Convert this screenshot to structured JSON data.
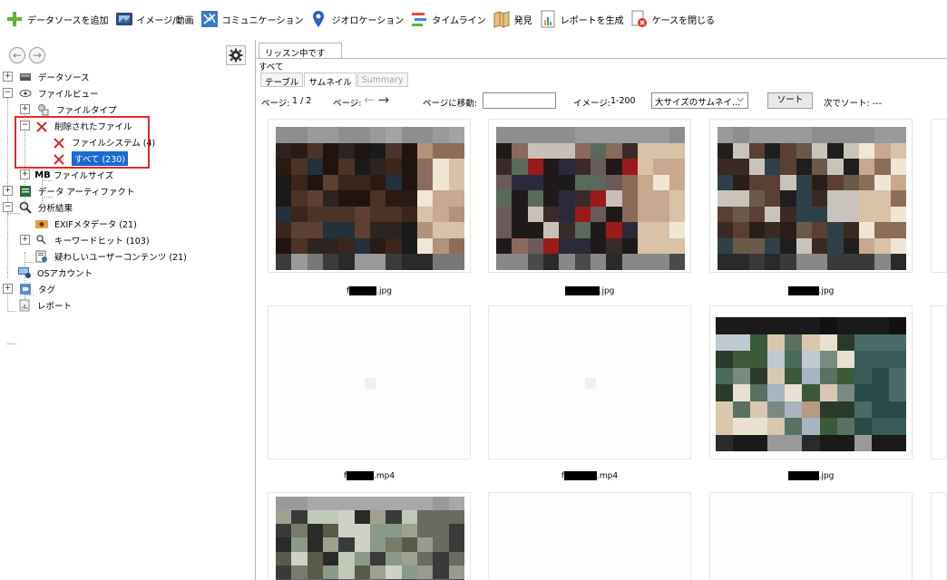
{
  "toolbar": {
    "items": [
      {
        "label": "データソースを追加",
        "icon": "add-plus-icon"
      },
      {
        "label": "イメージ/動画",
        "icon": "image-video-icon"
      },
      {
        "label": "コミュニケーション",
        "icon": "communication-icon"
      },
      {
        "label": "ジオロケーション",
        "icon": "geolocation-pin-icon"
      },
      {
        "label": "タイムライン",
        "icon": "timeline-icon"
      },
      {
        "label": "発見",
        "icon": "discovery-icon"
      },
      {
        "label": "レポートを生成",
        "icon": "report-icon"
      },
      {
        "label": "ケースを閉じる",
        "icon": "close-case-icon"
      }
    ]
  },
  "tree": {
    "items": [
      {
        "label": "データソース",
        "icon": "data-source-icon",
        "expander": "+"
      },
      {
        "label": "ファイルビュー",
        "icon": "eye-icon",
        "expander": "−"
      },
      {
        "label": "ファイルタイプ",
        "icon": "file-type-icon",
        "expander": "+"
      },
      {
        "label": "削除されたファイル",
        "icon": "deleted-file-icon",
        "expander": "−"
      },
      {
        "label": "ファイルシステム (4)",
        "icon": "deleted-file-icon"
      },
      {
        "label": "すべて (230)",
        "icon": "deleted-file-icon",
        "selected": true
      },
      {
        "label": "ファイルサイズ",
        "icon": "mb-icon",
        "icon_text": "MB",
        "expander": "+"
      },
      {
        "label": "データ アーティファクト",
        "icon": "artifact-icon",
        "expander": "+"
      },
      {
        "label": "分析結果",
        "icon": "magnifier-icon",
        "expander": "−"
      },
      {
        "label": "EXIFメタデータ (21)",
        "icon": "camera-icon"
      },
      {
        "label": "キーワードヒット (103)",
        "icon": "keyword-search-icon",
        "expander": "+"
      },
      {
        "label": "疑わしいユーザーコンテンツ (21)",
        "icon": "suspicious-content-icon"
      },
      {
        "label": "OSアカウント",
        "icon": "os-account-icon"
      },
      {
        "label": "タグ",
        "icon": "tag-icon",
        "expander": "+"
      },
      {
        "label": "レポート",
        "icon": "report-doc-icon"
      }
    ]
  },
  "results": {
    "tab_label": "リッスン中です",
    "breadcrumb": "すべて",
    "view_tabs": [
      "テーブル",
      "サムネイル",
      "Summary"
    ],
    "page_label": "ページ:",
    "page_value": "1 / 2",
    "page_nav_label": "ページ:",
    "goto_label": "ページに移動:",
    "goto_value": "",
    "image_label": "イメージ:",
    "image_range": "1-200",
    "size_select": "大サイズのサムネイ...",
    "sort_button": "ソート",
    "sort_by_label": "次でソート: ---"
  },
  "gallery": {
    "items": [
      {
        "caption_prefix": "f",
        "caption_suffix": ".jpg",
        "kind": "image"
      },
      {
        "caption_prefix": "",
        "caption_suffix": ".jpg",
        "kind": "image"
      },
      {
        "caption_prefix": "",
        "caption_suffix": ".jpg",
        "kind": "image"
      },
      {
        "caption_prefix": "f",
        "caption_suffix": ".mp4",
        "kind": "video"
      },
      {
        "caption_prefix": "f",
        "caption_suffix": ".mp4",
        "kind": "video"
      },
      {
        "caption_prefix": "",
        "caption_suffix": ".jpg",
        "kind": "image"
      }
    ]
  },
  "colors": {
    "selection": "#1b6ad0",
    "highlight_box": "#e02a2a"
  }
}
